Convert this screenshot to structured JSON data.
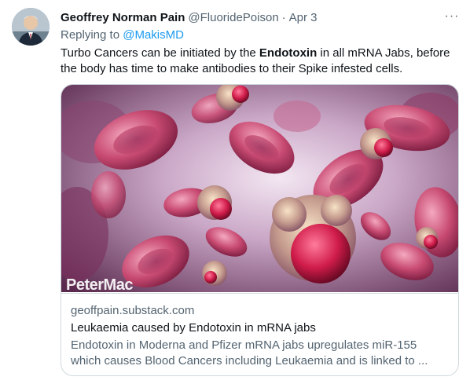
{
  "tweet": {
    "author_name": "Geoffrey Norman Pain",
    "handle": "@FluoridePoison",
    "separator": "·",
    "date": "Apr 3",
    "more_label": "···",
    "reply_prefix": "Replying to",
    "reply_to": "@MakisMD",
    "text_before": "Turbo Cancers can be initiated by the ",
    "text_bold": "Endotoxin",
    "text_after": " in all mRNA Jabs, before the body has time to make antibodies to their Spike infested cells."
  },
  "card": {
    "image_watermark": "PeterMac",
    "domain": "geoffpain.substack.com",
    "title": "Leukaemia caused by Endotoxin in mRNA jabs",
    "description_line1": "Endotoxin in Moderna and Pfizer mRNA jabs upregulates miR-155",
    "description_line2": "which causes Blood Cancers including Leukaemia and is linked to ..."
  },
  "icons": {
    "avatar": "profile-photo",
    "more": "more-icon"
  },
  "colors": {
    "link": "#1d9bf0",
    "secondary_text": "#536471",
    "primary_text": "#0f1419",
    "border": "#cfd9de"
  }
}
